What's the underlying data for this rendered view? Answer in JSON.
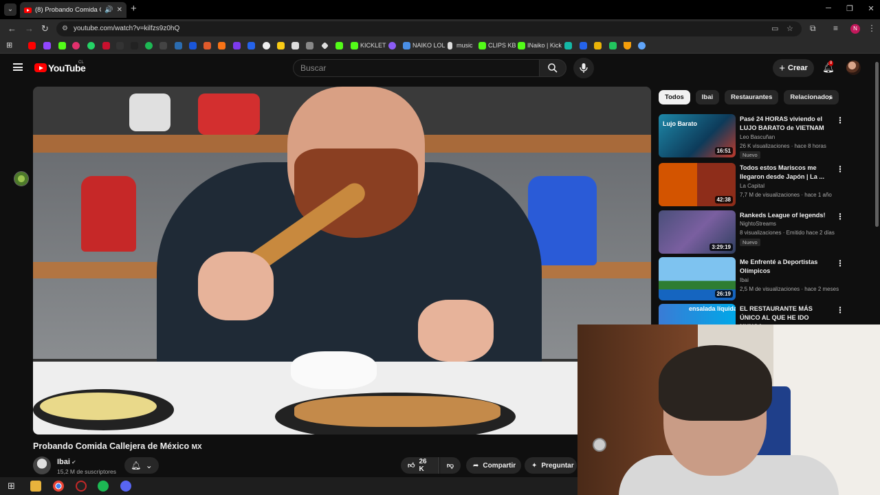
{
  "browser": {
    "tab_title": "(8) Probando Comida Calle",
    "tab_audio": "🔊",
    "tab_close": "✕",
    "new_tab": "+",
    "url": "youtube.com/watch?v=kilfzs9z0hQ",
    "window_minimize": "─",
    "window_maximize": "❐",
    "window_close": "✕",
    "profile_initial": "N"
  },
  "bookmarks": [
    {
      "label": "KICKLET",
      "color": "#53fc18"
    },
    {
      "label": "NAIKO LOL",
      "color": "#4a8fe7"
    },
    {
      "label": "music",
      "color": "#dddddd"
    },
    {
      "label": "CLIPS KB",
      "color": "#53fc18"
    },
    {
      "label": "INaiko | Kick",
      "color": "#53fc18"
    }
  ],
  "youtube": {
    "logo_text": "YouTube",
    "country_code": "CL",
    "search_placeholder": "Buscar",
    "create_label": "Crear",
    "notification_count": "8"
  },
  "video": {
    "title": "Probando Comida Callejera de México",
    "title_flag": "MX",
    "channel": "Ibai",
    "subscribers": "15,2 M de suscriptores",
    "likes": "26 K",
    "share_label": "Compartir",
    "ask_label": "Preguntar"
  },
  "chips": [
    "Todos",
    "Ibai",
    "Restaurantes",
    "Relacionados"
  ],
  "recommendations": [
    {
      "title": "Pasé 24 HORAS viviendo el LUJO BARATO de VIETNAM",
      "channel": "Leo Bascuñan",
      "meta": "26 K visualizaciones · hace 8 horas",
      "badge": "Nuevo",
      "duration": "16:51",
      "thumb_text": "Lujo Barato"
    },
    {
      "title": "Todos estos Mariscos me llegaron desde Japón | La ...",
      "channel": "La Capital",
      "meta": "7,7 M de visualizaciones · hace 1 año",
      "badge": "",
      "duration": "42:38",
      "thumb_text": ""
    },
    {
      "title": "Rankeds League of legends!",
      "channel": "NightoStreams",
      "meta": "8 visualizaciones · Emitido hace 2 días",
      "badge": "Nuevo",
      "duration": "3:29:19",
      "thumb_text": ""
    },
    {
      "title": "Me Enfrenté a Deportistas Olímpicos",
      "channel": "Ibai",
      "meta": "2,5 M de visualizaciones · hace 2 meses",
      "badge": "",
      "duration": "26:19",
      "thumb_text": ""
    },
    {
      "title": "EL RESTAURANTE MÁS ÚNICO AL QUE HE IDO NUNCA",
      "channel": "",
      "meta": "",
      "badge": "",
      "duration": "",
      "thumb_text": "ensalada líquida"
    }
  ],
  "colors": {
    "background": "#0f0f0f",
    "yt_red": "#ff0000",
    "chip_bg": "#272727",
    "text_secondary": "#aaaaaa"
  }
}
